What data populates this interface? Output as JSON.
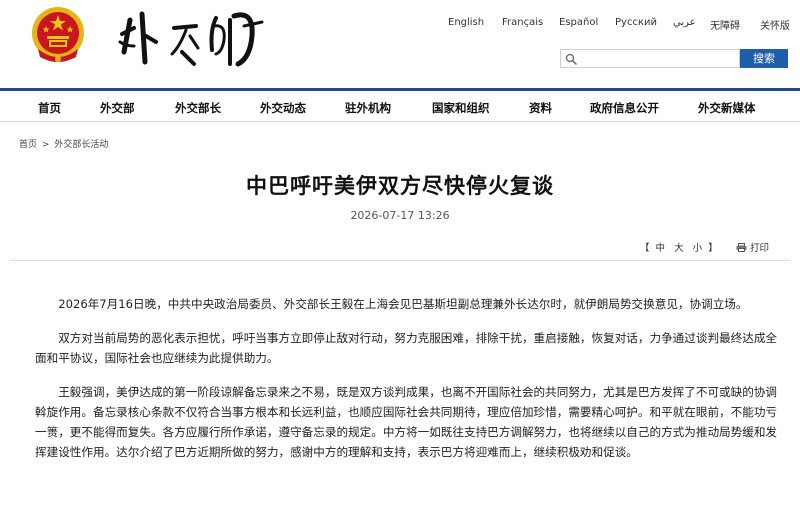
{
  "header": {
    "site_name": "外交部",
    "languages": [
      "English",
      "Français",
      "Español",
      "Русский",
      "عربي",
      "无障碍",
      "关怀版"
    ],
    "search": {
      "placeholder": "",
      "button_label": "搜索"
    }
  },
  "nav": {
    "items": [
      "首页",
      "外交部",
      "外交部长",
      "外交动态",
      "驻外机构",
      "国家和组织",
      "资料",
      "政府信息公开",
      "外交新媒体"
    ]
  },
  "breadcrumb": {
    "home": "首页",
    "separator": ">",
    "section": "外交部长活动"
  },
  "article": {
    "title": "中巴呼吁美伊双方尽快停火复谈",
    "date": "2026-07-17 13:26",
    "font_size_tool": {
      "open": "【",
      "sizes": [
        "中",
        "大",
        "小"
      ],
      "close": "】"
    },
    "print_label": "打印",
    "paragraphs": [
      "2026年7月16日晚，中共中央政治局委员、外交部长王毅在上海会见巴基斯坦副总理兼外长达尔时，就伊朗局势交换意见，协调立场。",
      "双方对当前局势的恶化表示担忧，呼吁当事方立即停止敌对行动，努力克服困难，排除干扰，重启接触，恢复对话，力争通过谈判最终达成全面和平协议，国际社会也应继续为此提供助力。",
      "王毅强调，美伊达成的第一阶段谅解备忘录来之不易，既是双方谈判成果，也离不开国际社会的共同努力，尤其是巴方发挥了不可或缺的协调斡旋作用。备忘录核心条款不仅符合当事方根本和长远利益，也顺应国际社会共同期待，理应倍加珍惜，需要精心呵护。和平就在眼前，不能功亏一篑，更不能得而复失。各方应履行所作承诺，遵守备忘录的规定。中方将一如既往支持巴方调解努力，也将继续以自己的方式为推动局势缓和发挥建设性作用。达尔介绍了巴方近期所做的努力，感谢中方的理解和支持，表示巴方将迎难而上，继续积极劝和促谈。"
    ]
  },
  "colors": {
    "nav_border": "#1e4d8c",
    "search_button": "#1f5ea8",
    "emblem_red": "#c8161d",
    "emblem_gold": "#f3c416"
  }
}
